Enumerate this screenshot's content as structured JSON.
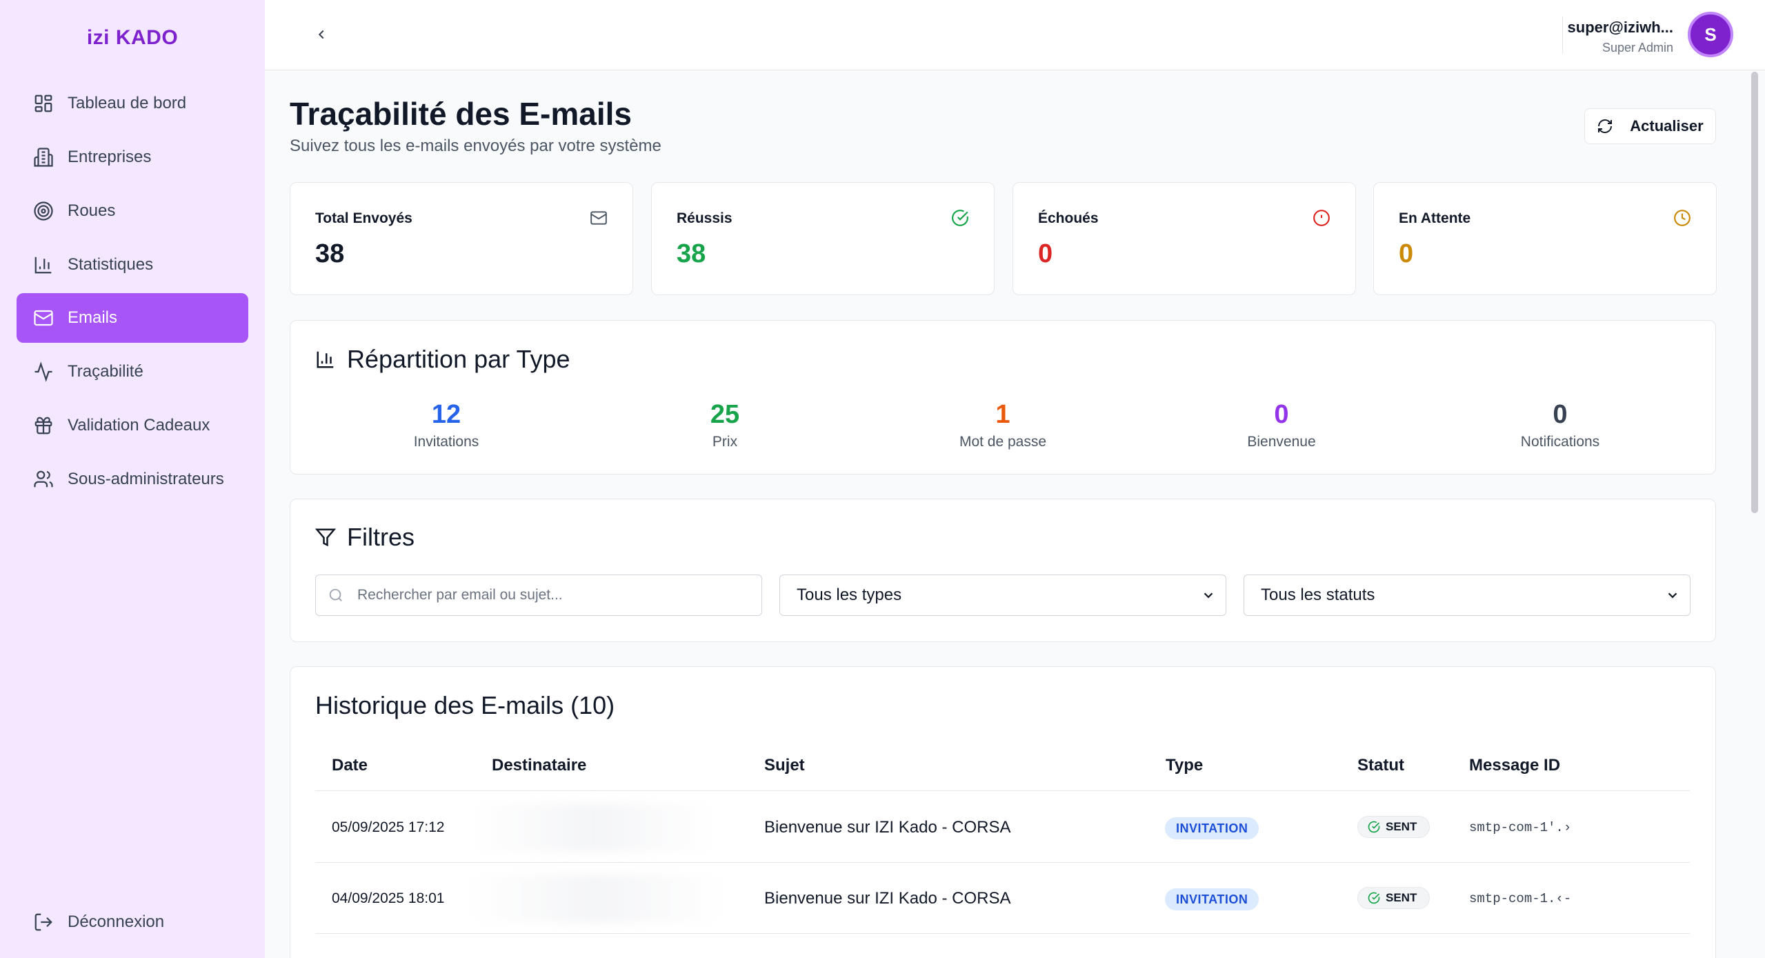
{
  "brand": {
    "prefix": "izi",
    "name": "KADO"
  },
  "sidebar": {
    "items": [
      {
        "label": "Tableau de bord",
        "icon": "dashboard-icon",
        "active": false
      },
      {
        "label": "Entreprises",
        "icon": "building-icon",
        "active": false
      },
      {
        "label": "Roues",
        "icon": "target-icon",
        "active": false
      },
      {
        "label": "Statistiques",
        "icon": "bar-chart-icon",
        "active": false
      },
      {
        "label": "Emails",
        "icon": "mail-icon",
        "active": true
      },
      {
        "label": "Traçabilité",
        "icon": "activity-icon",
        "active": false
      },
      {
        "label": "Validation Cadeaux",
        "icon": "gift-icon",
        "active": false
      },
      {
        "label": "Sous-administrateurs",
        "icon": "users-icon",
        "active": false
      }
    ],
    "logout": "Déconnexion"
  },
  "topbar": {
    "user_email": "super@iziwh...",
    "user_role": "Super Admin",
    "avatar_initial": "S"
  },
  "header": {
    "title": "Traçabilité des E-mails",
    "subtitle": "Suivez tous les e-mails envoyés par votre système",
    "refresh_label": "Actualiser"
  },
  "stats": [
    {
      "label": "Total Envoyés",
      "value": "38",
      "color": "#111827",
      "icon": "mail-icon"
    },
    {
      "label": "Réussis",
      "value": "38",
      "color": "#16a34a",
      "icon": "check-circle-icon"
    },
    {
      "label": "Échoués",
      "value": "0",
      "color": "#dc2626",
      "icon": "alert-circle-icon"
    },
    {
      "label": "En Attente",
      "value": "0",
      "color": "#ca8a04",
      "icon": "clock-icon"
    }
  ],
  "breakdown": {
    "title": "Répartition par Type",
    "types": [
      {
        "value": "12",
        "label": "Invitations",
        "color": "#2563eb"
      },
      {
        "value": "25",
        "label": "Prix",
        "color": "#16a34a"
      },
      {
        "value": "1",
        "label": "Mot de passe",
        "color": "#ea580c"
      },
      {
        "value": "0",
        "label": "Bienvenue",
        "color": "#9333ea"
      },
      {
        "value": "0",
        "label": "Notifications",
        "color": "#374151"
      }
    ]
  },
  "filters": {
    "title": "Filtres",
    "search_placeholder": "Rechercher par email ou sujet...",
    "type_select": "Tous les types",
    "status_select": "Tous les statuts"
  },
  "history": {
    "title": "Historique des E-mails (10)",
    "columns": [
      "Date",
      "Destinataire",
      "Sujet",
      "Type",
      "Statut",
      "Message ID"
    ],
    "rows": [
      {
        "date": "05/09/2025 17:12",
        "recipient": "",
        "subject": "Bienvenue sur IZI Kado - CORSA",
        "type": "INVITATION",
        "status": "SENT",
        "message_id": "smtp-com-1'.›"
      },
      {
        "date": "04/09/2025 18:01",
        "recipient": "",
        "subject": "Bienvenue sur IZI Kado - CORSA",
        "type": "INVITATION",
        "status": "SENT",
        "message_id": "smtp-com-1.‹-"
      }
    ]
  }
}
